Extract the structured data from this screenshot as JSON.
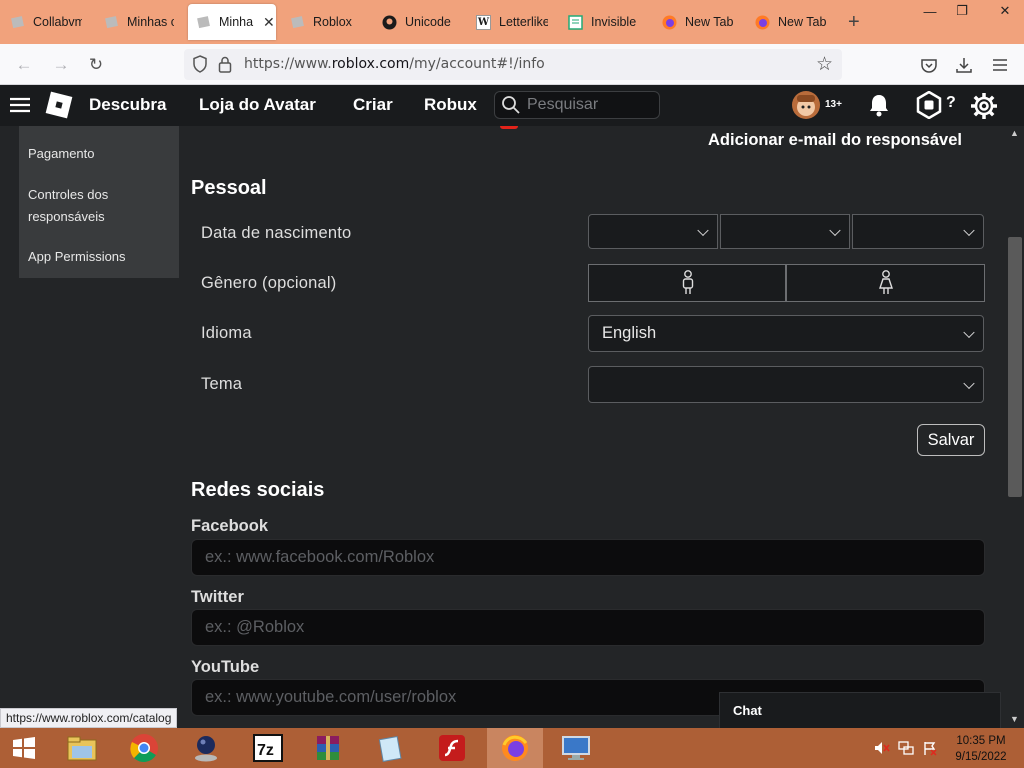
{
  "browser": {
    "tabs": [
      {
        "label": "Collabvm",
        "icon": "roblox-studio-icon"
      },
      {
        "label": "Minhas c",
        "icon": "roblox-studio-icon"
      },
      {
        "label": "Minha",
        "icon": "roblox-studio-icon",
        "active": true
      },
      {
        "label": "Roblox",
        "icon": "roblox-studio-icon"
      },
      {
        "label": "Unicode",
        "icon": "github-icon"
      },
      {
        "label": "Letterlike",
        "icon": "wikipedia-icon"
      },
      {
        "label": "Invisible",
        "icon": "page-icon"
      },
      {
        "label": "New Tab",
        "icon": "firefox-icon"
      },
      {
        "label": "New Tab",
        "icon": "firefox-icon"
      }
    ],
    "url_prefix": "https://www.",
    "url_domain": "roblox.com",
    "url_path": "/my/account#!/info",
    "status_url": "https://www.roblox.com/catalog",
    "tabbar_color": "#f1a27c"
  },
  "header": {
    "nav": [
      "Descubra",
      "Loja do Avatar",
      "Criar",
      "Robux"
    ],
    "search_placeholder": "Pesquisar",
    "age_badge": "13+"
  },
  "sidebar": {
    "items": [
      "Pagamento",
      "Controles dos responsáveis",
      "App Permissions"
    ]
  },
  "main": {
    "add_parent_email": "Adicionar e-mail do responsável",
    "personal_title": "Pessoal",
    "birthdate_label": "Data de nascimento",
    "gender_label": "Gênero (opcional)",
    "language_label": "Idioma",
    "language_value": "English",
    "theme_label": "Tema",
    "theme_value": "",
    "save_label": "Salvar",
    "social_title": "Redes sociais",
    "facebook_label": "Facebook",
    "facebook_placeholder": "ex.: www.facebook.com/Roblox",
    "twitter_label": "Twitter",
    "twitter_placeholder": "ex.: @Roblox",
    "youtube_label": "YouTube",
    "youtube_placeholder": "ex.: www.youtube.com/user/roblox"
  },
  "chat": {
    "label": "Chat"
  },
  "taskbar": {
    "time": "10:35 PM",
    "date": "9/15/2022",
    "color": "#ad5f36"
  }
}
